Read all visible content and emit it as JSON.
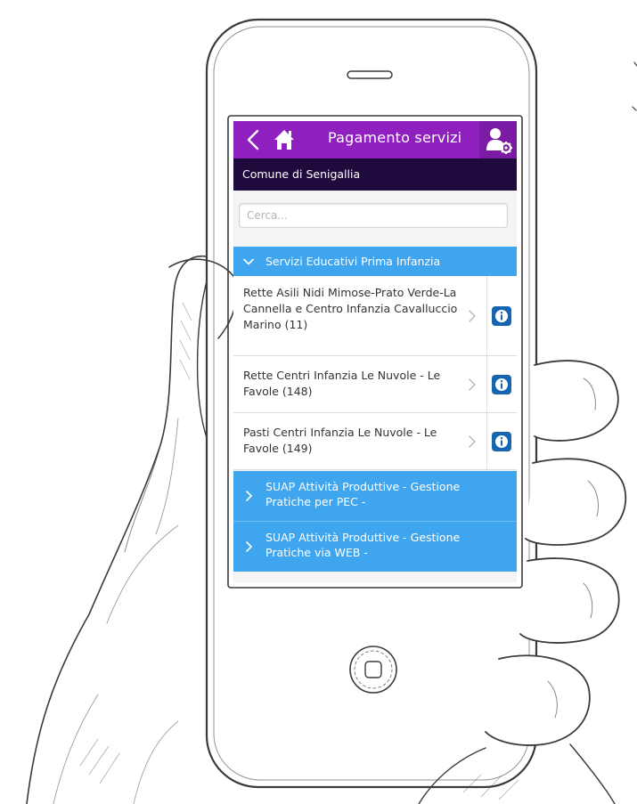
{
  "header": {
    "title": "Pagamento servizi",
    "back_icon": "chevron-left-icon",
    "home_icon": "home-icon",
    "user_icon": "user-settings-icon"
  },
  "subheader": {
    "text": "Comune di Senigallia"
  },
  "search": {
    "placeholder": "Cerca...",
    "value": ""
  },
  "categories": [
    {
      "label": "Servizi Educativi Prima Infanzia",
      "expanded": true,
      "items": [
        {
          "label": "Rette Asili Nidi Mimose-Prato Verde-La Cannella e Centro Infanzia Cavalluccio Marino (11)"
        },
        {
          "label": "Rette Centri Infanzia Le Nuvole - Le Favole (148)"
        },
        {
          "label": "Pasti Centri Infanzia Le Nuvole - Le Favole (149)"
        }
      ]
    },
    {
      "label": "SUAP Attività Produttive - Gestione Pratiche per PEC -",
      "expanded": false
    },
    {
      "label": "SUAP Attività Produttive - Gestione Pratiche via WEB -",
      "expanded": false
    }
  ],
  "colors": {
    "header": "#8f1fbf",
    "subheader": "#1e0a3c",
    "category": "#3fa5ee",
    "info_button": "#1565b0"
  }
}
